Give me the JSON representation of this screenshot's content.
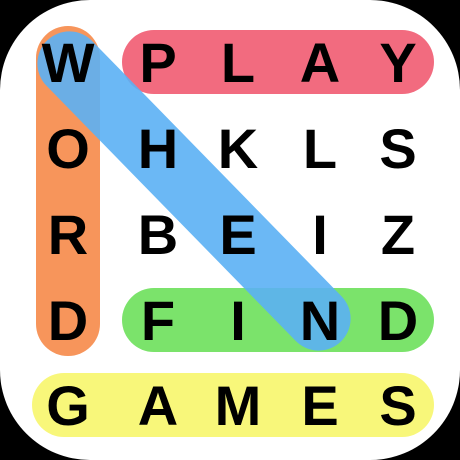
{
  "puzzle": {
    "grid": [
      [
        "W",
        "P",
        "L",
        "A",
        "Y"
      ],
      [
        "O",
        "H",
        "K",
        "L",
        "S"
      ],
      [
        "R",
        "B",
        "E",
        "I",
        "Z"
      ],
      [
        "D",
        "F",
        "I",
        "N",
        "D"
      ],
      [
        "G",
        "A",
        "M",
        "E",
        "S"
      ]
    ]
  },
  "highlights": [
    {
      "word": "PLAY",
      "direction": "horizontal",
      "row": 0,
      "from_col": 1,
      "to_col": 4,
      "color": "#f26b7f"
    },
    {
      "word": "WORD",
      "direction": "vertical",
      "col": 0,
      "from_row": 0,
      "to_row": 3,
      "color": "#f7955b"
    },
    {
      "word": "FIND",
      "direction": "horizontal",
      "row": 3,
      "from_col": 1,
      "to_col": 4,
      "color": "#7be36b"
    },
    {
      "word": "GAMES",
      "direction": "horizontal",
      "row": 4,
      "from_col": 0,
      "to_col": 4,
      "color": "#f8f77a"
    },
    {
      "word": "WHEN",
      "direction": "diagonal",
      "from": [
        0,
        0
      ],
      "to": [
        3,
        3
      ],
      "color": "#5bb0f4"
    }
  ],
  "colors": {
    "background": "#ffffff",
    "outer": "#000000",
    "letter": "#000000"
  }
}
